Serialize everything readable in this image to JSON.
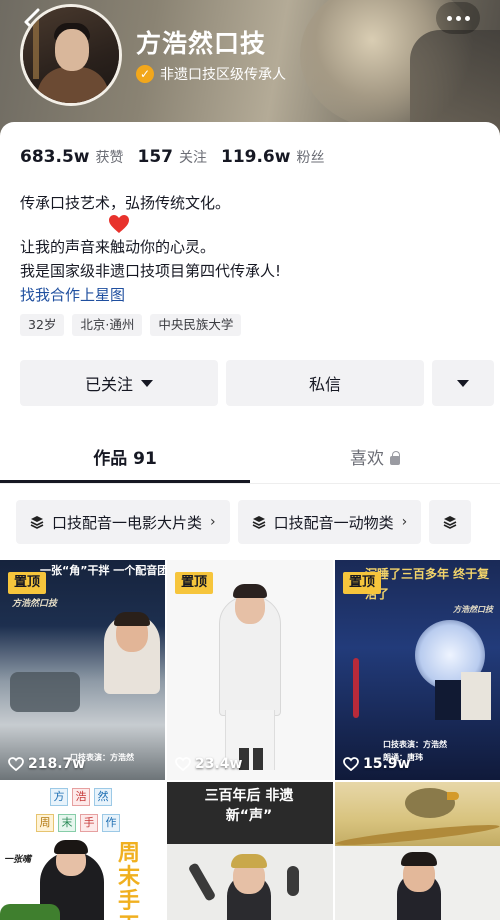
{
  "header": {
    "username": "方浩然口技",
    "badge_text": "非遗口技区级传承人",
    "back_icon": "chevron-left-icon",
    "more_icon": "more-dots-icon"
  },
  "stats": [
    {
      "value": "683.5w",
      "label": "获赞"
    },
    {
      "value": "157",
      "label": "关注"
    },
    {
      "value": "119.6w",
      "label": "粉丝"
    }
  ],
  "bio": {
    "line1": "传承口技艺术，弘扬传统文化。",
    "line2": "让我的声音来触动你的心灵。",
    "line3": "我是国家级非遗口技项目第四代传承人!",
    "link": "找我合作上星图"
  },
  "tags": [
    "32岁",
    "北京·通州",
    "中央民族大学"
  ],
  "actions": {
    "follow_label": "已关注",
    "message_label": "私信"
  },
  "tabs": {
    "works_label": "作品 91",
    "likes_label": "喜欢"
  },
  "collections": [
    {
      "label": "口技配音一电影大片类"
    },
    {
      "label": "口技配音一动物类"
    }
  ],
  "videos": [
    {
      "pinned": "置顶",
      "likes": "218.7w",
      "overlay_top": "一张“角”干拌  一个配音团队",
      "overlay_logo": "方浩然口技",
      "caption": "口技表演：方浩然"
    },
    {
      "pinned": "置顶",
      "likes": "23.4w"
    },
    {
      "pinned": "置顶",
      "likes": "15.9w",
      "overlay_top": "沉睡了三百多年  终于复活了",
      "overlay_logo": "方浩然口技",
      "caption": "口技表演：方浩然  朗诵：唐玮"
    },
    {
      "title_words": [
        "方",
        "浩",
        "然",
        "周",
        "末",
        "手",
        "作"
      ],
      "side_text": "周末手工",
      "logo": "一张嘴"
    },
    {
      "overlay_top": "三百年后 非遗新“声”"
    },
    {}
  ],
  "colors": {
    "accent_yellow": "#f6c53c",
    "link_blue": "#1f4f9f",
    "badge_orange": "#f2a71b",
    "heart_red": "#e8322c"
  }
}
